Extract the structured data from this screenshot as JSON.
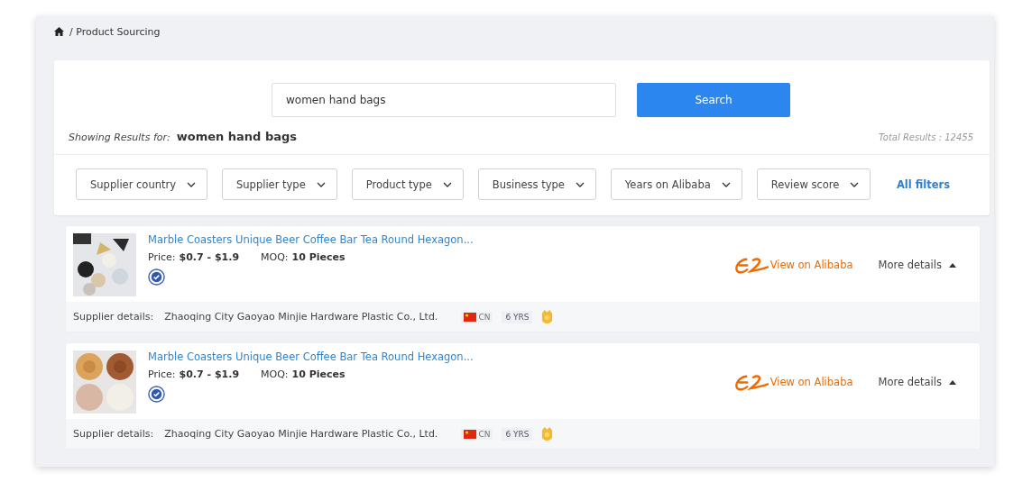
{
  "breadcrumb": {
    "current": "/ Product Sourcing"
  },
  "search": {
    "value": "women hand bags",
    "button": "Search"
  },
  "results_summary": {
    "label": "Showing Results for:",
    "query": "women hand bags",
    "total": "Total Results :  12455"
  },
  "filters": [
    {
      "label": "Supplier country"
    },
    {
      "label": "Supplier type"
    },
    {
      "label": "Product type"
    },
    {
      "label": "Business type"
    },
    {
      "label": "Years on Alibaba"
    },
    {
      "label": "Review score"
    }
  ],
  "all_filters": "All filters",
  "products": [
    {
      "kind": "picture",
      "title": "Marble Coasters Unique Beer Coffee Bar Tea Round Hexagon...",
      "price_label": "Price:",
      "price": "$0.7 - $1.9",
      "moq_label": "MOQ:",
      "moq": "10 Pieces",
      "view_link": "View on Alibaba",
      "more_details": "More details",
      "supplier_label": "Supplier details:",
      "supplier": "Zhaoqing City Gaoyao Minjie Hardware Plastic Co., Ltd.",
      "country": "CN",
      "years": "6 YRS"
    },
    {
      "kind": "picture",
      "title": "Marble Coasters Unique Beer Coffee Bar Tea Round Hexagon...",
      "price_label": "Price:",
      "price": "$0.7 - $1.9",
      "moq_label": "MOQ:",
      "moq": "10 Pieces",
      "view_link": "View on Alibaba",
      "more_details": "More details",
      "supplier_label": "Supplier details:",
      "supplier": "Zhaoqing City Gaoyao Minjie Hardware Plastic Co., Ltd.",
      "country": "CN",
      "years": "6 YRS"
    }
  ]
}
